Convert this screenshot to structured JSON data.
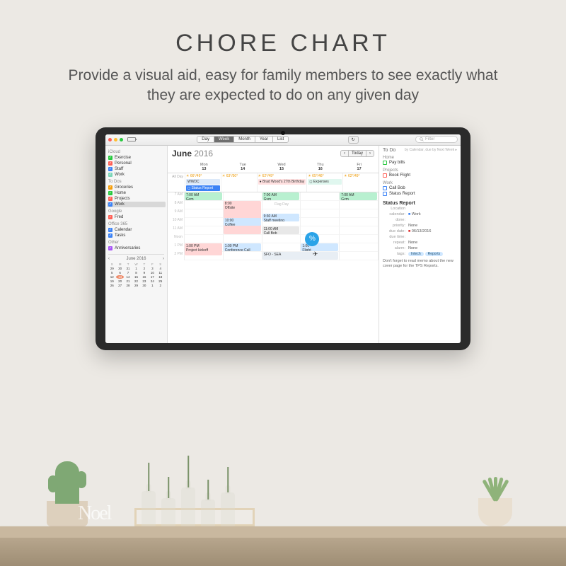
{
  "hero": {
    "title": "CHORE CHART",
    "subtitle": "Provide a visual aid, easy for family members to see exactly what they are expected to do on any given day"
  },
  "toolbar": {
    "views": [
      "Day",
      "Week",
      "Month",
      "Year",
      "List"
    ],
    "active_view": "Week",
    "refresh_icon": "↻",
    "filter_placeholder": "Filter"
  },
  "sidebar": {
    "sections": [
      {
        "name": "iCloud",
        "items": [
          {
            "label": "Exercise",
            "color": "#27c93f"
          },
          {
            "label": "Personal",
            "color": "#ff5f56"
          },
          {
            "label": "Staff",
            "color": "#3b82f6"
          },
          {
            "label": "Work",
            "color": "#7bd6b8"
          }
        ]
      },
      {
        "name": "To Dos",
        "items": [
          {
            "label": "Groceries",
            "color": "#f59e0b"
          },
          {
            "label": "Home",
            "color": "#27c93f"
          },
          {
            "label": "Projects",
            "color": "#ff5f56"
          },
          {
            "label": "Work",
            "color": "#3b82f6",
            "selected": true
          }
        ]
      },
      {
        "name": "Google",
        "items": [
          {
            "label": "Fred",
            "color": "#ff5f56"
          }
        ]
      },
      {
        "name": "Office 365",
        "items": [
          {
            "label": "Calendar",
            "color": "#3b82f6"
          },
          {
            "label": "Tasks",
            "color": "#3b82f6"
          }
        ]
      },
      {
        "name": "Other",
        "items": [
          {
            "label": "Anniversaries",
            "color": "#a855f7"
          }
        ]
      }
    ],
    "mini_cal": {
      "label": "June 2016",
      "dow": [
        "S",
        "M",
        "T",
        "W",
        "T",
        "F",
        "S"
      ],
      "days": [
        "29",
        "30",
        "31",
        "1",
        "2",
        "3",
        "4",
        "5",
        "6",
        "7",
        "8",
        "9",
        "10",
        "11",
        "12",
        "13",
        "14",
        "15",
        "16",
        "17",
        "18",
        "19",
        "20",
        "21",
        "22",
        "23",
        "24",
        "25",
        "26",
        "27",
        "28",
        "29",
        "30",
        "1",
        "2"
      ],
      "today": "13"
    }
  },
  "calendar": {
    "month": "June",
    "year": "2016",
    "nav": {
      "prev": "‹",
      "today": "Today",
      "next": "›"
    },
    "days": [
      {
        "label": "Mon",
        "num": "13",
        "weather": "66°/49°"
      },
      {
        "label": "Tue",
        "num": "14",
        "weather": "63°/50°"
      },
      {
        "label": "Wed",
        "num": "15",
        "weather": "62°/49°"
      },
      {
        "label": "Thu",
        "num": "16",
        "weather": "65°/48°"
      },
      {
        "label": "Fri",
        "num": "17",
        "weather": "62°/49°"
      }
    ],
    "allday_label": "All Day",
    "allday": {
      "wwdc": "WWDC",
      "status": "Status Report",
      "bday": "Brad Wood's 27th Birthday",
      "expenses": "Expenses"
    },
    "flag_day": "Flag Day",
    "times": [
      "7 AM",
      "8 AM",
      "9 AM",
      "10 AM",
      "11 AM",
      "Noon",
      "1 PM",
      "2 PM"
    ],
    "events": {
      "gym_mon": "7:00 AM\nGym",
      "gym_wed": "7:00 AM\nGym",
      "gym_fri": "7:00 AM\nGym",
      "offsite": "8:00\nOffsite",
      "coffee": "10:00\nCoffee",
      "staff": "9:30 AM\nStaff meeting",
      "callbob": "11:00 AM\nCall Bob",
      "conf": "1:00 PM\nConference Call",
      "kickoff": "1:00 PM\nProject kickoff",
      "flight": "1:00\nFlight",
      "sfo": "SFO - SEA"
    }
  },
  "todo": {
    "title": "To Do",
    "subtitle": "by Calendar, due by Next Week",
    "sections": [
      {
        "name": "Home",
        "items": [
          {
            "label": "Pay bills",
            "color": "green"
          }
        ]
      },
      {
        "name": "Projects",
        "items": [
          {
            "label": "Book Flight",
            "color": "red"
          }
        ]
      },
      {
        "name": "Work",
        "items": [
          {
            "label": "Call Bob",
            "color": "blue"
          },
          {
            "label": "Status Report",
            "color": "blue"
          }
        ]
      }
    ],
    "detail": {
      "title": "Status Report",
      "fields": [
        {
          "k": "Location",
          "v": ""
        },
        {
          "k": "calendar:",
          "v": "Work"
        },
        {
          "k": "done:",
          "v": ""
        },
        {
          "k": "priority:",
          "v": "None"
        },
        {
          "k": "due date:",
          "v": "06/13/2016"
        },
        {
          "k": "due time:",
          "v": ""
        },
        {
          "k": "repeat:",
          "v": "None"
        },
        {
          "k": "alarm:",
          "v": "None"
        },
        {
          "k": "tags:",
          "v": ""
        }
      ],
      "tags": [
        "Intech",
        "Reports"
      ],
      "note": "Don't forget to read memo about the new cover page for the TPS Reports."
    }
  },
  "decor": {
    "noel": "Noel"
  }
}
